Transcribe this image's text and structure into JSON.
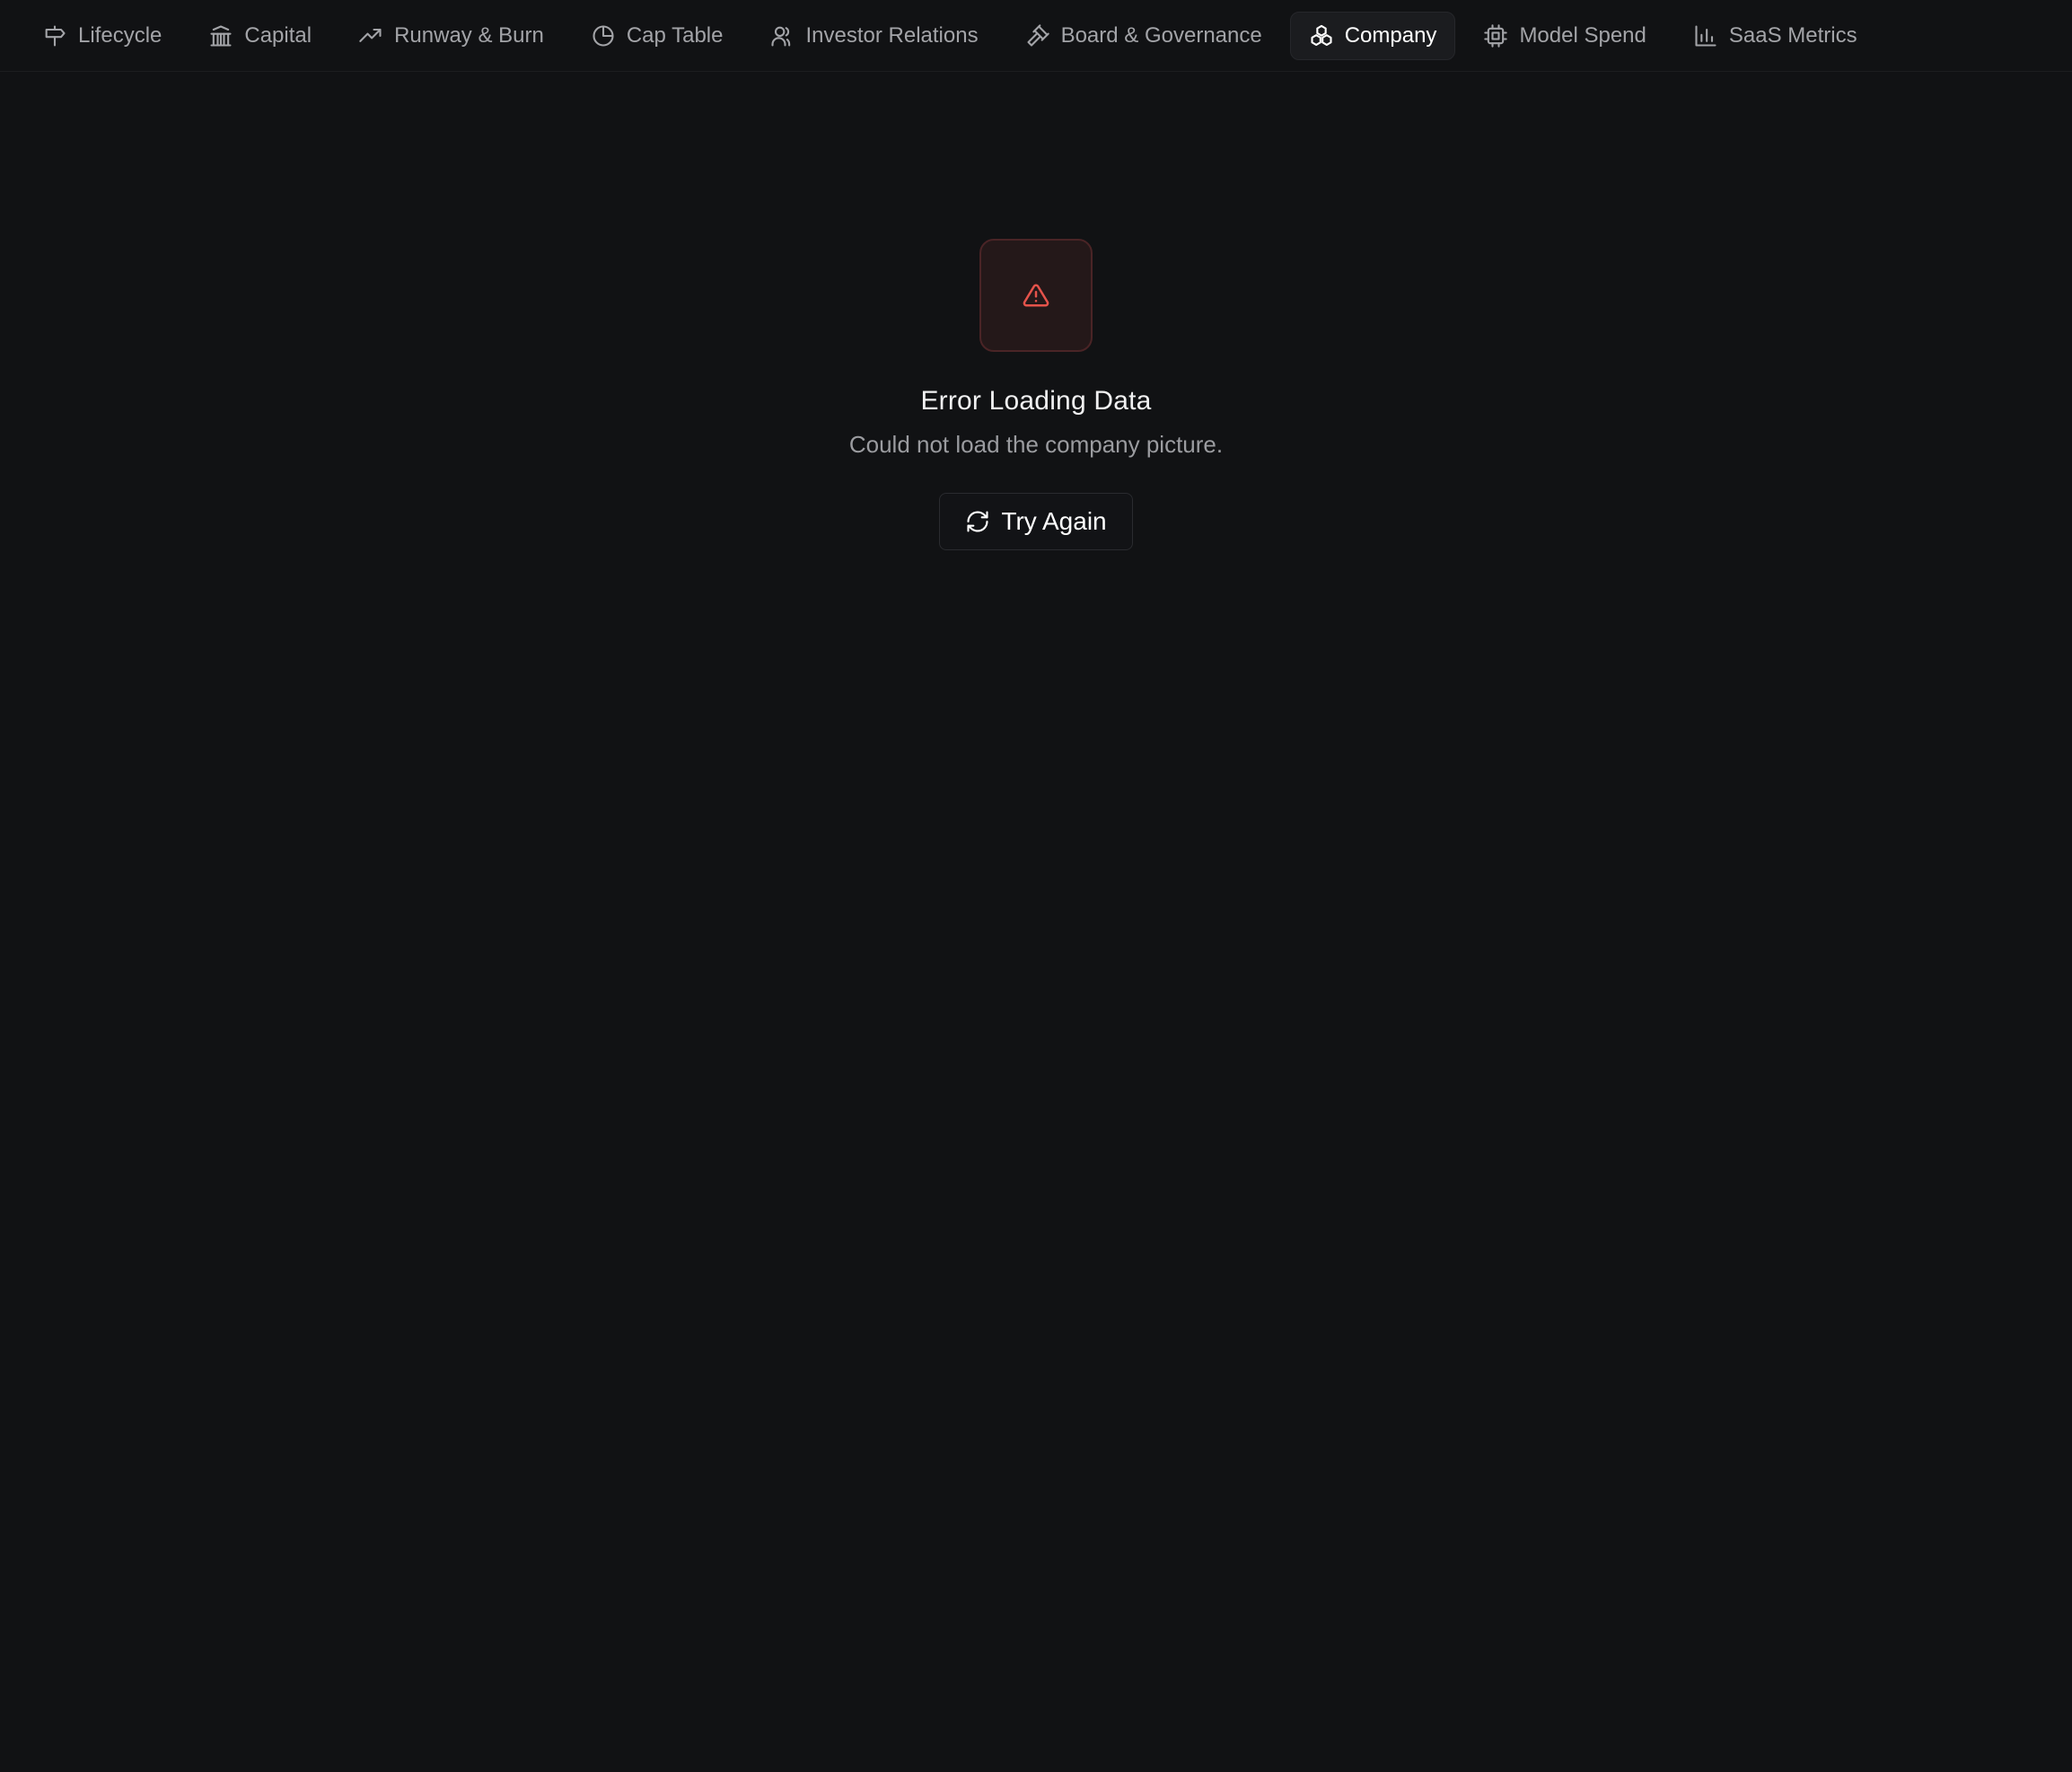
{
  "nav": {
    "tabs": [
      {
        "label": "Lifecycle",
        "icon": "signpost-icon"
      },
      {
        "label": "Capital",
        "icon": "bank-icon"
      },
      {
        "label": "Runway & Burn",
        "icon": "trending-up-icon"
      },
      {
        "label": "Cap Table",
        "icon": "pie-chart-icon"
      },
      {
        "label": "Investor Relations",
        "icon": "users-icon"
      },
      {
        "label": "Board & Governance",
        "icon": "gavel-icon"
      },
      {
        "label": "Company",
        "icon": "boxes-icon"
      },
      {
        "label": "Model Spend",
        "icon": "cpu-icon"
      },
      {
        "label": "SaaS Metrics",
        "icon": "bar-chart-icon"
      }
    ],
    "active_tab": "Company"
  },
  "error": {
    "icon": "alert-triangle-icon",
    "title": "Error Loading Data",
    "message": "Could not load the company picture.",
    "retry_label": "Try Again",
    "retry_icon": "refresh-icon"
  },
  "colors": {
    "background": "#111214",
    "error_accent": "#e5534b",
    "error_box_bg": "#241819",
    "active_tab_bg": "#1b1c1f"
  }
}
